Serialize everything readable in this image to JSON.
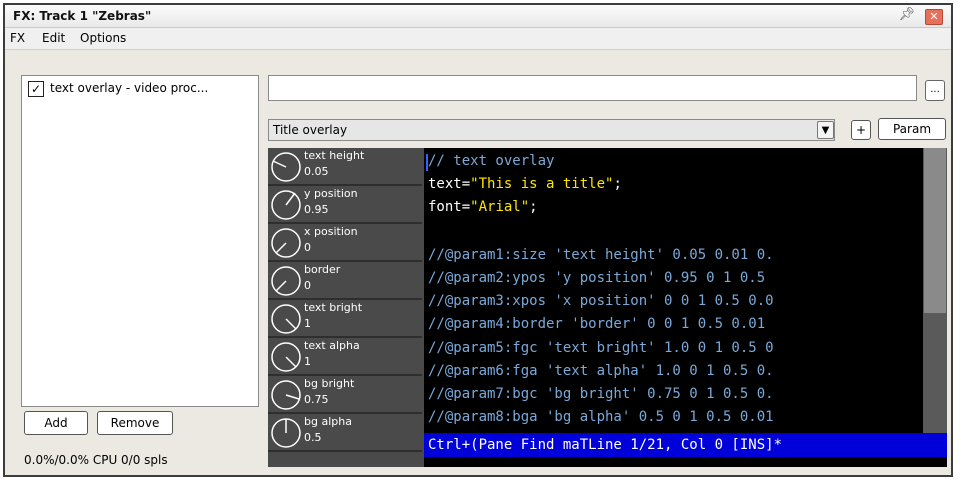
{
  "window": {
    "title": "FX: Track 1 \"Zebras\""
  },
  "menu": {
    "items": [
      "FX",
      "Edit",
      "Options"
    ]
  },
  "fx_list": {
    "items": [
      {
        "label": "text overlay - video proc...",
        "checked": true
      }
    ]
  },
  "buttons": {
    "add": "Add",
    "remove": "Remove",
    "ellipsis": "...",
    "plus": "+",
    "param": "Param"
  },
  "cpu_status": "0.0%/0.0% CPU 0/0 spls",
  "preset": {
    "value": "Title overlay"
  },
  "params": [
    {
      "label": "text height",
      "value": "0.05"
    },
    {
      "label": "y position",
      "value": "0.95"
    },
    {
      "label": "x position",
      "value": "0"
    },
    {
      "label": "border",
      "value": "0"
    },
    {
      "label": "text bright",
      "value": "1"
    },
    {
      "label": "text alpha",
      "value": "1"
    },
    {
      "label": "bg bright",
      "value": "0.75"
    },
    {
      "label": "bg alpha",
      "value": "0.5"
    }
  ],
  "code": {
    "line1": "// text overlay",
    "line2_a": "text=",
    "line2_b": "\"This is a title\"",
    "line2_c": ";",
    "line3_a": "font=",
    "line3_b": "\"Arial\"",
    "line3_c": ";",
    "line5": "//@param1:size 'text height' 0.05 0.01 0.",
    "line6": "//@param2:ypos 'y position' 0.95 0 1 0.5",
    "line7": "//@param3:xpos 'x position' 0 0 1 0.5 0.0",
    "line8": "//@param4:border 'border' 0 0 1 0.5 0.01",
    "line9": "//@param5:fgc 'text bright' 1.0 0 1 0.5 0",
    "line10": "//@param6:fga 'text alpha' 1.0 0 1 0.5 0.",
    "line11": "//@param7:bgc 'bg bright' 0.75 0 1 0.5 0.",
    "line12": "//@param8:bga 'bg alpha' 0.5 0 1 0.5 0.01"
  },
  "editor_status": "Ctrl+(Pane Find maTLine 1/21, Col 0 [INS]*",
  "icons": {
    "pin": "pin-icon",
    "close": "close-icon",
    "dropdown": "chevron-down-icon",
    "checkbox": "checkbox-checked-icon"
  }
}
